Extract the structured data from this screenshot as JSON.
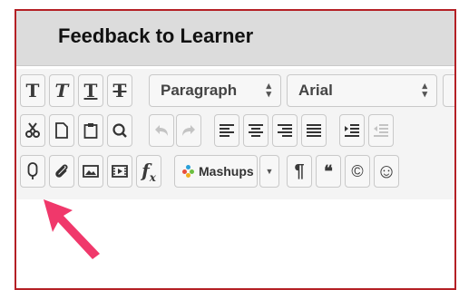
{
  "header": {
    "title": "Feedback to Learner"
  },
  "toolbar": {
    "row1": {
      "bold": "T",
      "italic": "T",
      "underline": "T",
      "strike": "T",
      "paragraph_select": "Paragraph",
      "font_select": "Arial"
    },
    "row3": {
      "math_label": "f",
      "math_sub": "x",
      "mashups_label": "Mashups",
      "pilcrow": "¶",
      "quote": "❝",
      "copyright": "©",
      "emoji": "☺"
    }
  },
  "colors": {
    "frame_border": "#b42025",
    "header_bg": "#dcdcdc",
    "arrow": "#f0386b"
  },
  "icons": [
    "cut-icon",
    "copy-icon",
    "paste-icon",
    "find-icon",
    "undo-icon",
    "redo-icon",
    "align-left-icon",
    "align-center-icon",
    "align-right-icon",
    "justify-icon",
    "indent-icon",
    "outdent-icon",
    "microphone-icon",
    "attachment-icon",
    "image-icon",
    "video-icon",
    "arrow-pointer-icon"
  ]
}
